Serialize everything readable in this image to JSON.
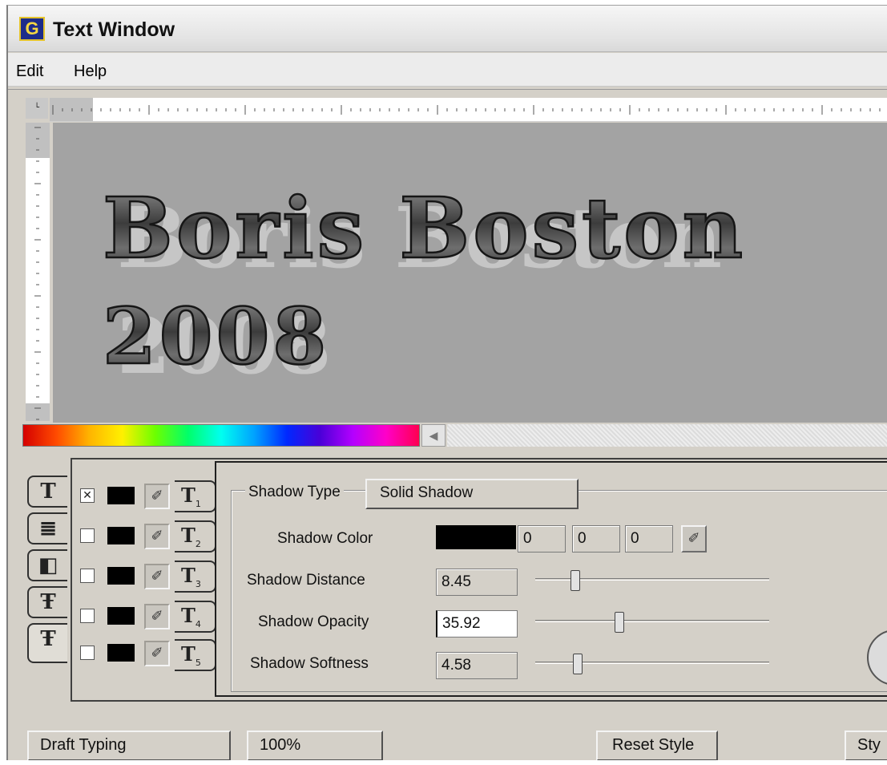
{
  "window": {
    "title": "Text Window",
    "app_icon_letter": "G"
  },
  "menu": {
    "items": [
      "Edit",
      "Help"
    ]
  },
  "canvas": {
    "text_lines": [
      "Boris Boston",
      "2008"
    ],
    "background": "#a3a3a3"
  },
  "style_tabs": [
    {
      "icon": "T",
      "name": "text-style"
    },
    {
      "icon": "≣",
      "name": "alignment"
    },
    {
      "icon": "◧",
      "name": "gradient"
    },
    {
      "icon": "Ŧ",
      "name": "outline"
    },
    {
      "icon": "Ŧ",
      "name": "shadow"
    }
  ],
  "shadow_rows": [
    {
      "checked": true,
      "tab_number": "1"
    },
    {
      "checked": false,
      "tab_number": "2"
    },
    {
      "checked": false,
      "tab_number": "3"
    },
    {
      "checked": false,
      "tab_number": "4"
    },
    {
      "checked": false,
      "tab_number": "5"
    }
  ],
  "shadow": {
    "type_label": "Shadow Type",
    "type_value": "Solid Shadow",
    "color_label": "Shadow Color",
    "color_hex": "#000000",
    "color_rgb": [
      "0",
      "0",
      "0"
    ],
    "distance_label": "Shadow Distance",
    "distance_value": "8.45",
    "distance_fraction": 0.17,
    "opacity_label": "Shadow Opacity",
    "opacity_value": "35.92",
    "opacity_fraction": 0.36,
    "softness_label": "Shadow Softness",
    "softness_value": "4.58",
    "softness_fraction": 0.18
  },
  "bottom_bar": {
    "draft_typing": "Draft Typing",
    "zoom": "100%",
    "reset_style": "Reset Style",
    "style_partial": "Sty"
  }
}
